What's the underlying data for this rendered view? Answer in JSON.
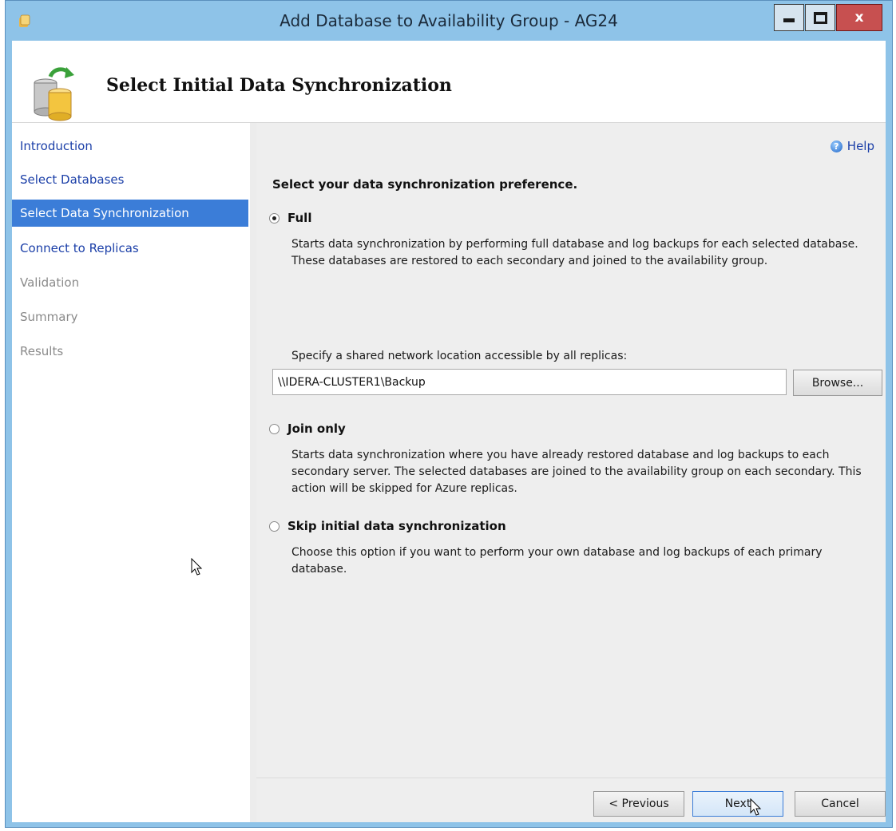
{
  "window": {
    "title": "Add Database to Availability Group - AG24",
    "controls": {
      "minimize": "minimize",
      "maximize": "maximize",
      "close": "x"
    }
  },
  "header": {
    "title": "Select Initial Data Synchronization",
    "icon": "database-sync-icon"
  },
  "sidebar": {
    "items": [
      {
        "label": "Introduction",
        "state": "link"
      },
      {
        "label": "Select Databases",
        "state": "link"
      },
      {
        "label": "Select Data Synchronization",
        "state": "active"
      },
      {
        "label": "Connect to Replicas",
        "state": "link"
      },
      {
        "label": "Validation",
        "state": "disabled"
      },
      {
        "label": "Summary",
        "state": "disabled"
      },
      {
        "label": "Results",
        "state": "disabled"
      }
    ]
  },
  "content": {
    "help_label": "Help",
    "prompt": "Select your data synchronization preference.",
    "options": [
      {
        "label": "Full",
        "selected": true,
        "description": "Starts data synchronization by performing full database and log backups for each selected database. These databases are restored to each secondary and joined to the availability group."
      },
      {
        "label": "Join only",
        "selected": false,
        "description": "Starts data synchronization where you have already restored database and log backups to each secondary server. The selected databases are joined to the availability group on each secondary. This action will be skipped for Azure replicas."
      },
      {
        "label": "Skip initial data synchronization",
        "selected": false,
        "description": "Choose this option if you want to perform your own database and log backups of each primary database."
      }
    ],
    "location_label": "Specify a shared network location accessible by all replicas:",
    "location_value": "\\\\IDERA-CLUSTER1\\Backup",
    "browse_label": "Browse..."
  },
  "footer": {
    "previous_label": "< Previous",
    "next_label": "Next",
    "cancel_label": "Cancel"
  },
  "colors": {
    "frame": "#8ec3e8",
    "active_nav": "#3b7dd8",
    "link": "#1b3fa8",
    "close_button": "#c75050"
  }
}
